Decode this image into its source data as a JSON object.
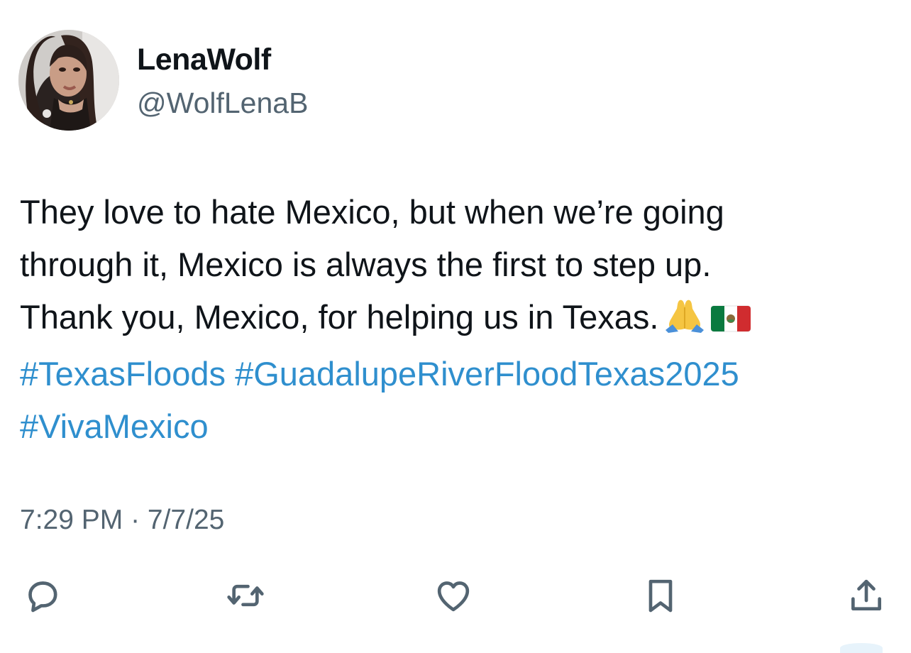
{
  "author": {
    "display_name": "LenaWolf",
    "handle": "@WolfLenaB",
    "avatar_icon": "profile-photo"
  },
  "tweet": {
    "line1": "They love to hate Mexico, but when we’re going",
    "line2": "through it, Mexico is always the first to step up.",
    "line3": "Thank you, Mexico, for helping us in Texas.",
    "emoji_pray": "🙏",
    "emoji_flag": "🇲🇽",
    "hashtags": {
      "texas_floods": "#TexasFloods",
      "guadalupe": "#GuadalupeRiverFloodTexas2025",
      "viva_mexico": "#VivaMexico"
    }
  },
  "timestamp": "7:29 PM · 7/7/25",
  "actions": {
    "reply_icon": "reply-icon",
    "retweet_icon": "retweet-icon",
    "like_icon": "heart-icon",
    "bookmark_icon": "bookmark-icon",
    "share_icon": "share-icon"
  },
  "colors": {
    "text": "#0f1419",
    "secondary": "#536471",
    "link": "#2f8fce",
    "icon": "#536471"
  }
}
